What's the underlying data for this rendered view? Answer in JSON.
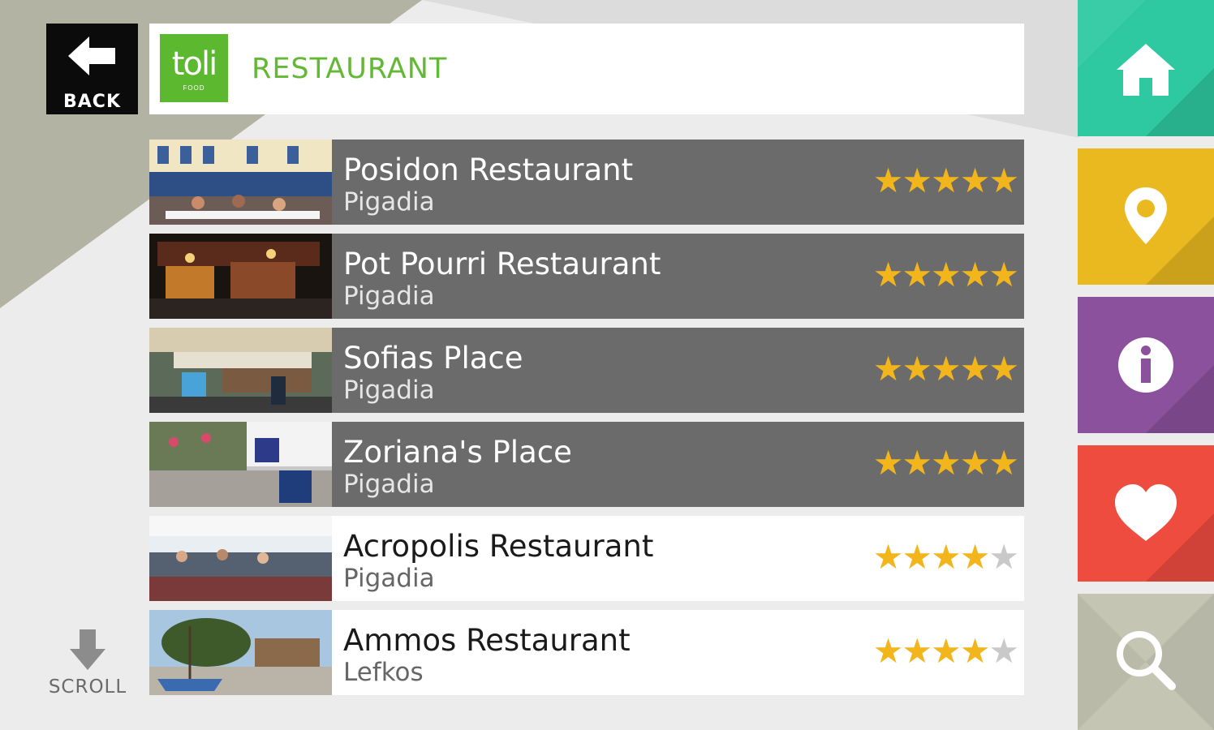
{
  "header": {
    "back_label": "BACK",
    "logo_text": "toli",
    "logo_subtext": "FOOD",
    "title": "RESTAURANT"
  },
  "restaurants": [
    {
      "name": "Posidon Restaurant",
      "location": "Pigadia",
      "rating": 5,
      "style": "dark"
    },
    {
      "name": "Pot Pourri Restaurant",
      "location": "Pigadia",
      "rating": 5,
      "style": "dark"
    },
    {
      "name": "Sofias Place",
      "location": "Pigadia",
      "rating": 5,
      "style": "dark"
    },
    {
      "name": "Zoriana's Place",
      "location": "Pigadia",
      "rating": 5,
      "style": "dark"
    },
    {
      "name": "Acropolis Restaurant",
      "location": "Pigadia",
      "rating": 4,
      "style": "light"
    },
    {
      "name": "Ammos Restaurant",
      "location": "Lefkos",
      "rating": 4,
      "style": "light"
    }
  ],
  "max_rating": 5,
  "scroll": {
    "label": "SCROLL"
  },
  "side_nav": [
    {
      "id": "home",
      "icon": "home-icon",
      "color": "#2ec9a1"
    },
    {
      "id": "map",
      "icon": "map-pin-icon",
      "color": "#eab81f"
    },
    {
      "id": "info",
      "icon": "info-icon",
      "color": "#8c519c"
    },
    {
      "id": "favorites",
      "icon": "heart-icon",
      "color": "#ef4c40"
    },
    {
      "id": "search",
      "icon": "search-icon",
      "color": "#c4c5b3"
    }
  ],
  "colors": {
    "accent_green": "#63b835",
    "star_on": "#f2b51c",
    "star_off": "#c9c9c9",
    "row_dark": "#6b6b6b"
  }
}
